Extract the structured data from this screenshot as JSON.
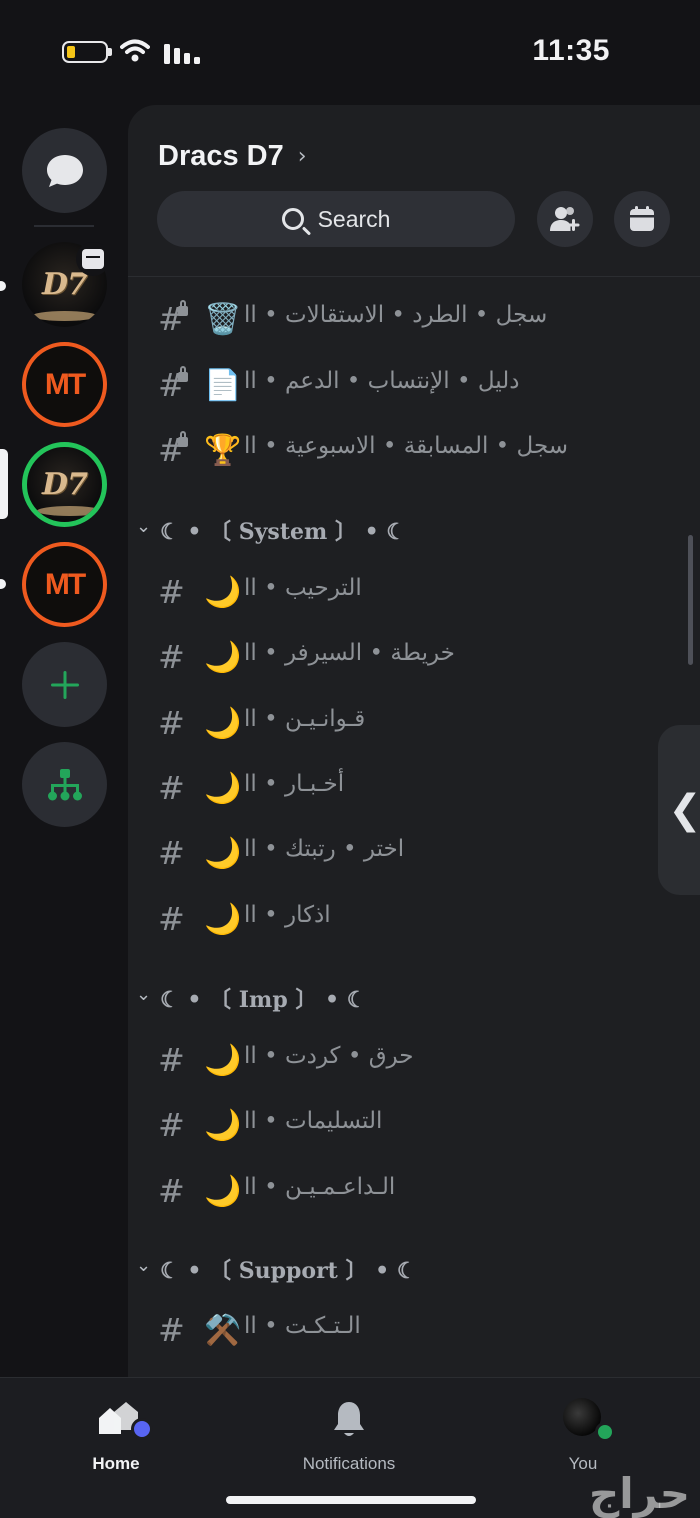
{
  "status_bar": {
    "time": "11:35",
    "battery_level": 0.2,
    "battery_color": "#f5c518"
  },
  "rail": {
    "dm_icon": "chat-bubble-icon",
    "servers": [
      {
        "name": "D7",
        "logo_text": "D7",
        "unread": true,
        "has_event": true,
        "selected": false
      },
      {
        "name": "MT",
        "logo_text": "MT",
        "unread": false,
        "selected": false
      },
      {
        "name": "D7",
        "logo_text": "D7",
        "unread": false,
        "selected": true
      },
      {
        "name": "MT",
        "logo_text": "MT",
        "unread": true,
        "selected": false
      }
    ],
    "add_icon": "plus-icon",
    "discover_icon": "hub-icon"
  },
  "header": {
    "server_name": "Dracs D7",
    "chevron": "›",
    "search_placeholder": "Search",
    "invite_icon": "add-member-icon",
    "events_icon": "calendar-icon"
  },
  "channels_top": [
    {
      "emoji": "🗑️",
      "name": "سجل • الطرد • الاستقالات • اا",
      "locked": true
    },
    {
      "emoji": "📄",
      "name": "دليل • الإنتساب • الدعم • اا",
      "locked": true
    },
    {
      "emoji": "🏆",
      "name": "سجل • المسابقة • الاسبوعية • اا",
      "locked": true
    }
  ],
  "categories": [
    {
      "label": "☾ • 〔 System 〕 • ☾",
      "channels": [
        {
          "emoji": "🌙",
          "name": "الترحيب • اا"
        },
        {
          "emoji": "🌙",
          "name": "خريطة • السيرفر • اا"
        },
        {
          "emoji": "🌙",
          "name": "قـوانـيـن • اا"
        },
        {
          "emoji": "🌙",
          "name": "أخـبـار • اا"
        },
        {
          "emoji": "🌙",
          "name": "اختر • رتبتك • اا"
        },
        {
          "emoji": "🌙",
          "name": "اذكار • اا"
        }
      ]
    },
    {
      "label": "☾ • 〔 Imp 〕 • ☾",
      "channels": [
        {
          "emoji": "🌙",
          "name": "حرق • كردت • اا"
        },
        {
          "emoji": "🌙",
          "name": "التسليمات • اا"
        },
        {
          "emoji": "🌙",
          "name": "الـداعـمـيـن • اا"
        }
      ]
    },
    {
      "label": "☾ • 〔 Support 〕 • ☾",
      "channels": [
        {
          "emoji": "⚒️",
          "name": "الـتـكـت • اا"
        }
      ]
    }
  ],
  "bottom_nav": {
    "home_label": "Home",
    "notifications_label": "Notifications",
    "you_label": "You"
  },
  "watermark_text": "حراج",
  "colors": {
    "accent": "#5865f2",
    "online": "#23a55a",
    "mt_orange": "#ef5a1f",
    "channel_text": "#8e9297"
  }
}
